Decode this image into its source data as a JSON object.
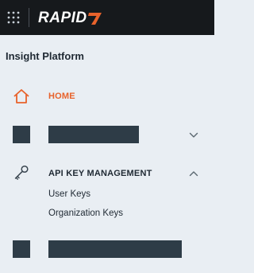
{
  "topbar": {
    "apps_icon": "grid-dots-icon",
    "brand_text": "RAPID",
    "brand_mark": "rapid7-seven-mark",
    "brand_accent": "#e8622b"
  },
  "sidebar": {
    "section_title": "Insight Platform",
    "items": [
      {
        "label": "HOME",
        "icon": "home-icon",
        "color": "#e8622b",
        "active": true
      },
      {
        "label": "",
        "icon": "redacted-placeholder",
        "expanded": false,
        "redacted": true
      },
      {
        "label": "API KEY MANAGEMENT",
        "icon": "key-icon",
        "expanded": true,
        "children": [
          {
            "label": "User Keys"
          },
          {
            "label": "Organization Keys"
          }
        ]
      },
      {
        "label": "",
        "icon": "redacted-placeholder",
        "redacted": true
      }
    ]
  },
  "colors": {
    "topbar_bg": "#16191c",
    "sidebar_bg": "#e9eef3",
    "text": "#1f2933",
    "accent": "#e8622b",
    "placeholder": "#2e3c47"
  }
}
